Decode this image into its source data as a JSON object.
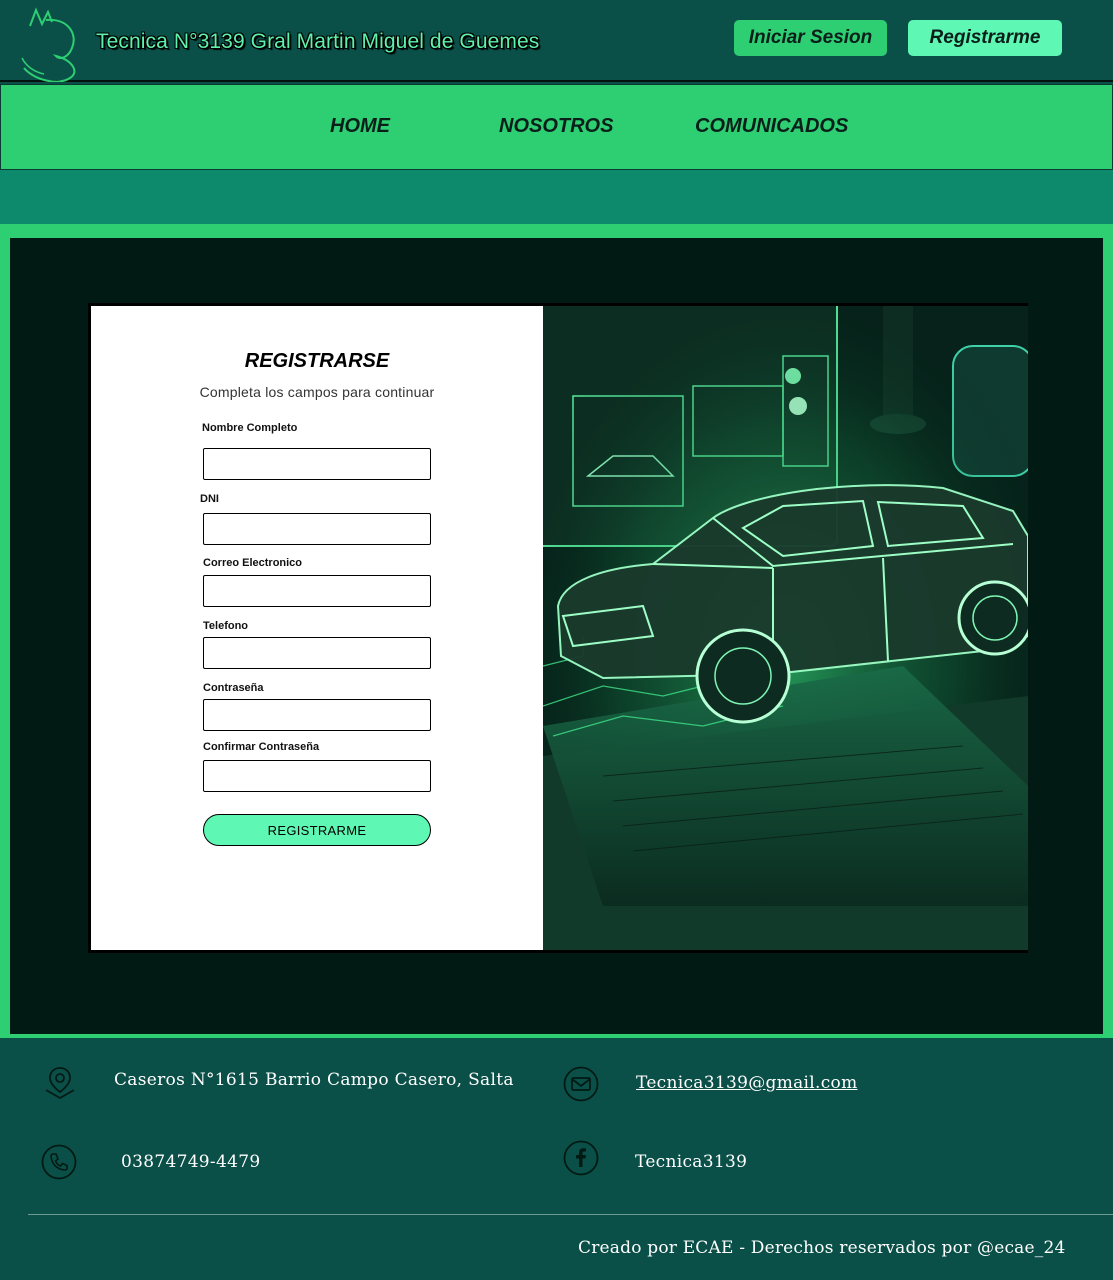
{
  "header": {
    "title": "Tecnica N°3139 Gral  Martin Miguel de Guemes",
    "login_label": "Iniciar Sesion",
    "register_label": "Registrarme"
  },
  "nav": {
    "items": [
      {
        "label": "HOME"
      },
      {
        "label": "NOSOTROS"
      },
      {
        "label": "COMUNICADOS"
      }
    ]
  },
  "form": {
    "title": "REGISTRARSE",
    "subtitle": "Completa los campos para continuar",
    "fields": [
      {
        "label": "Nombre Completo",
        "value": ""
      },
      {
        "label": "DNI",
        "value": ""
      },
      {
        "label": "Correo Electronico",
        "value": ""
      },
      {
        "label": "Telefono",
        "value": ""
      },
      {
        "label": "Contraseña",
        "value": ""
      },
      {
        "label": "Confirmar Contraseña",
        "value": ""
      }
    ],
    "submit_label": "REGISTRARME"
  },
  "footer": {
    "address": "Caseros N°1615 Barrio Campo Casero, Salta",
    "email": "Tecnica3139@gmail.com",
    "phone": "03874749-4479",
    "facebook": "Tecnica3139",
    "credits": "Creado por ECAE - Derechos reservados por @ecae_24"
  },
  "icons": {
    "logo": "school-logo-icon",
    "address": "location-pin-icon",
    "email": "mail-icon",
    "phone": "phone-icon",
    "facebook": "facebook-icon"
  },
  "colors": {
    "header_bg": "#0b5048",
    "accent_green": "#2ecf72",
    "mint": "#5ef7b4",
    "dark_panel": "#021a14"
  }
}
